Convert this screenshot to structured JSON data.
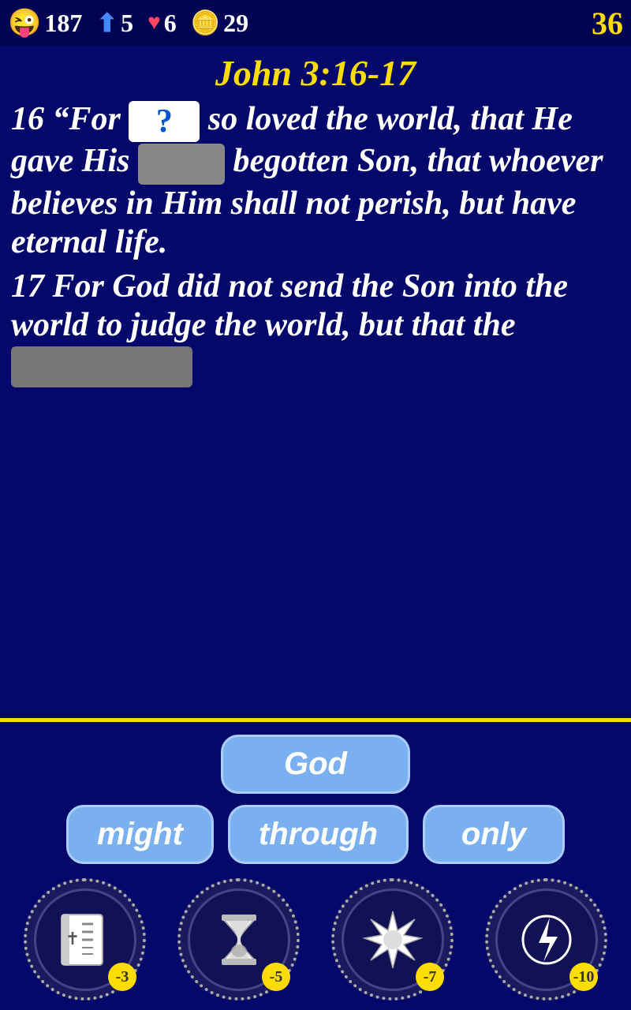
{
  "header": {
    "emoji": "😜",
    "emoji_count": "187",
    "arrow_count": "5",
    "heart_count": "6",
    "coin_count": "29",
    "score": "36"
  },
  "verse": {
    "title": "John 3:16-17",
    "blank1_display": "?",
    "text_part1": "16 “For",
    "text_part2": "so loved the world, that He gave His",
    "text_part3": "begotten Son, that whoever believes in Him shall not perish, but have eternal life.",
    "text_part4": "17 For God did not send the Son into the world to judge the world, but that the",
    "blank2_hint": "",
    "blank3_hint": ""
  },
  "answers": {
    "top_btn": "God",
    "btn_left": "might",
    "btn_center": "through",
    "btn_right": "only"
  },
  "toolbar": {
    "btn1_badge": "-3",
    "btn2_badge": "-5",
    "btn3_badge": "-7",
    "btn4_badge": "-10"
  }
}
